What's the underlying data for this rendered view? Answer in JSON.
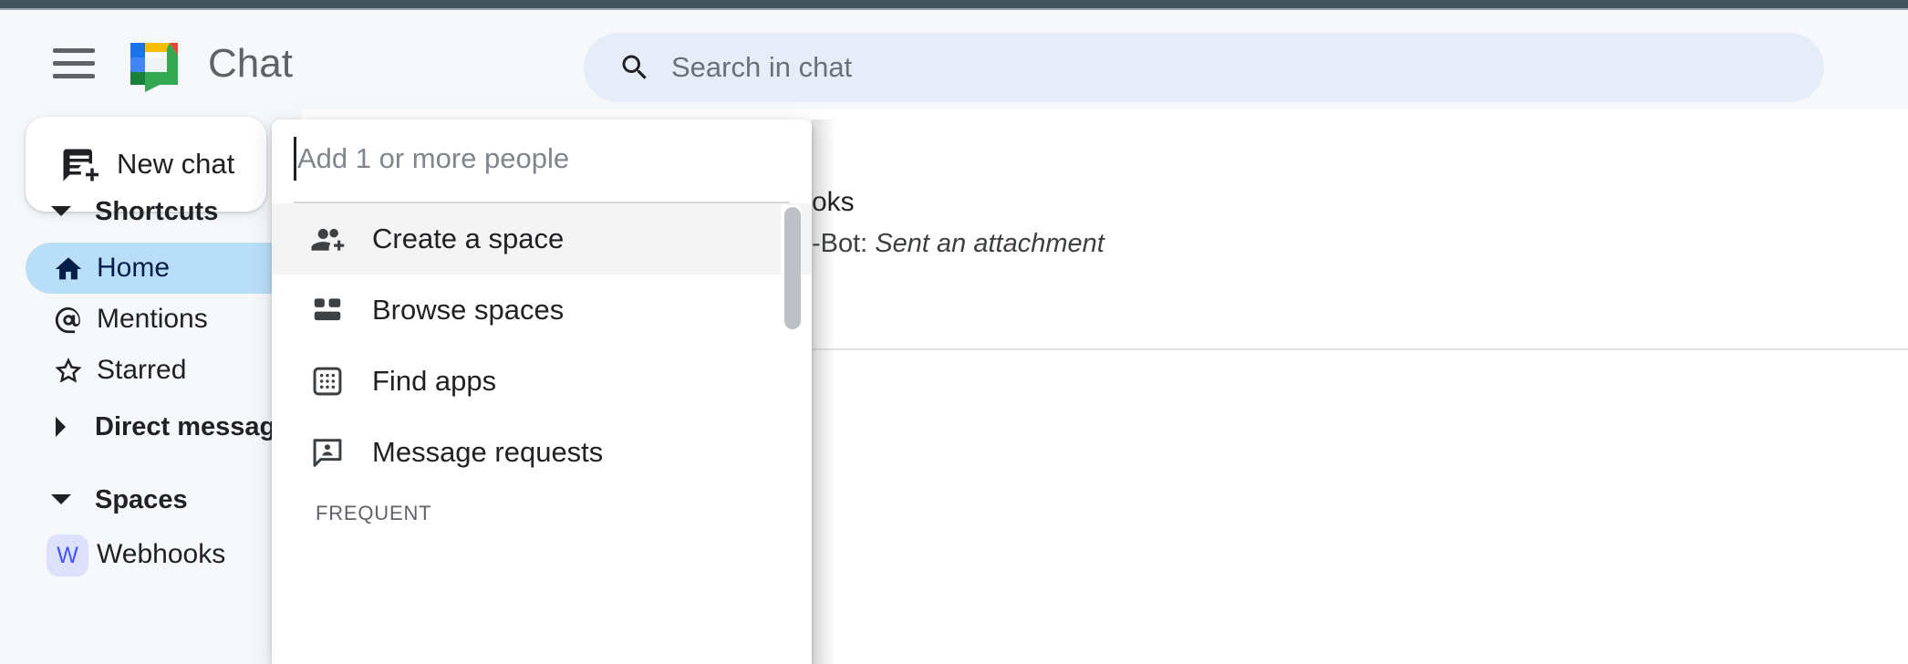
{
  "window": {
    "chrome_bar_color": "#44545d"
  },
  "header": {
    "menu_icon": "hamburger-menu-icon",
    "logo_icon": "google-chat-logo",
    "title": "Chat",
    "search": {
      "icon": "search-icon",
      "placeholder": "Search in chat",
      "value": "",
      "background": "#e7edf8"
    }
  },
  "sidebar": {
    "new_chat": {
      "icon": "new-chat-icon",
      "label": "New chat"
    },
    "sections": [
      {
        "label": "Shortcuts",
        "expanded": true,
        "caret": "chevron-down-icon"
      },
      {
        "label": "Direct messages",
        "expanded": false,
        "caret": "chevron-right-icon"
      },
      {
        "label": "Spaces",
        "expanded": true,
        "caret": "chevron-down-icon"
      }
    ],
    "shortcuts": [
      {
        "label": "Home",
        "icon": "home-icon",
        "active": true
      },
      {
        "label": "Mentions",
        "icon": "at-mention-icon",
        "active": false
      },
      {
        "label": "Starred",
        "icon": "star-icon",
        "active": false
      }
    ],
    "spaces": [
      {
        "label": "Webhooks",
        "avatar_letter": "W",
        "avatar_bg": "#dee1fc",
        "avatar_fg": "#4255ff"
      }
    ],
    "active_color": "#b9def8"
  },
  "main": {
    "chat_row": {
      "title_partial": "oks",
      "snippet_prefix": "-Bot: ",
      "snippet_italic": "Sent an attachment"
    }
  },
  "dropdown": {
    "input": {
      "placeholder": "Add 1 or more people",
      "value": ""
    },
    "items": [
      {
        "label": "Create a space",
        "icon": "person-add-icon",
        "hovered": true
      },
      {
        "label": "Browse spaces",
        "icon": "browse-spaces-icon",
        "hovered": false
      },
      {
        "label": "Find apps",
        "icon": "apps-grid-icon",
        "hovered": false
      },
      {
        "label": "Message requests",
        "icon": "message-request-icon",
        "hovered": false
      }
    ],
    "section_label": "FREQUENT",
    "scrollbar": {
      "name": "dropdown-scrollbar",
      "thumb_color": "#bdc1c6"
    }
  }
}
